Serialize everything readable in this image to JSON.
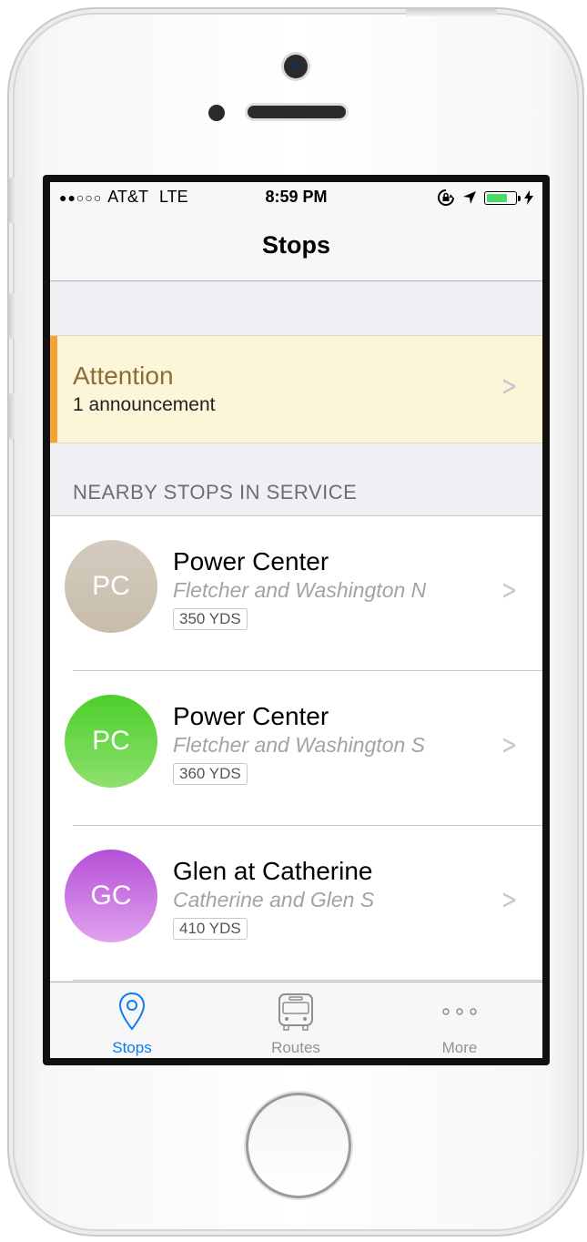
{
  "status_bar": {
    "signal": "●●○○○",
    "carrier": "AT&T",
    "network": "LTE",
    "time": "8:59 PM",
    "battery_level": 0.8,
    "battery_color": "#4cd964"
  },
  "nav": {
    "title": "Stops"
  },
  "announcement": {
    "title": "Attention",
    "subtitle": "1 announcement",
    "accent_color": "#f5a236"
  },
  "section_header": "NEARBY STOPS IN SERVICE",
  "stops": [
    {
      "initials": "PC",
      "name": "Power Center",
      "street": "Fletcher and Washington N",
      "distance": "350 YDS",
      "color_top": "#d3cbbf",
      "color_bottom": "#c8bda9"
    },
    {
      "initials": "PC",
      "name": "Power Center",
      "street": "Fletcher and Washington S",
      "distance": "360 YDS",
      "color_top": "#4ccf2a",
      "color_bottom": "#8ee06f"
    },
    {
      "initials": "GC",
      "name": "Glen at Catherine",
      "street": "Catherine and Glen S",
      "distance": "410 YDS",
      "color_top": "#b44fd6",
      "color_bottom": "#e0a3ef"
    }
  ],
  "tabs": [
    {
      "label": "Stops",
      "icon": "location-pin-icon",
      "active": true
    },
    {
      "label": "Routes",
      "icon": "bus-icon",
      "active": false
    },
    {
      "label": "More",
      "icon": "more-dots-icon",
      "active": false
    }
  ],
  "accent_color": "#0a7cf4"
}
